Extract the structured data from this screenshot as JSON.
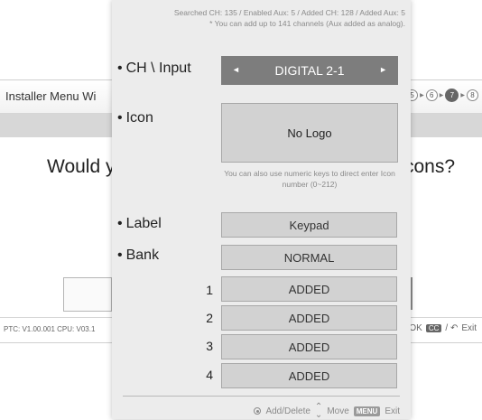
{
  "background": {
    "title": "Installer Menu Wi",
    "steps": [
      "5",
      "6",
      "7",
      "8"
    ],
    "active_step": "7",
    "question_left": "Would y",
    "question_right": "cons?",
    "version": "PTC: V1.00.001 CPU: V03.1",
    "nav_ok": "OK",
    "nav_cc": "CC",
    "nav_exit": "Exit"
  },
  "dialog": {
    "info_line1": "Searched CH: 135 / Enabled Aux: 5 / Added CH: 128 / Added Aux: 5",
    "info_line2": "* You can add up to 141 channels (Aux added as analog).",
    "ch_input_label": "CH \\ Input",
    "ch_input_value": "DIGITAL 2-1",
    "icon_label": "Icon",
    "icon_value": "No Logo",
    "icon_hint": "You can also use numeric keys to direct enter Icon number (0~212)",
    "label_label": "Label",
    "label_value": "Keypad",
    "bank_label": "Bank",
    "bank_value": "NORMAL",
    "banks": [
      {
        "num": "1",
        "status": "ADDED"
      },
      {
        "num": "2",
        "status": "ADDED"
      },
      {
        "num": "3",
        "status": "ADDED"
      },
      {
        "num": "4",
        "status": "ADDED"
      }
    ],
    "footer": {
      "add_delete": "Add/Delete",
      "move": "Move",
      "menu": "MENU",
      "exit": "Exit"
    }
  }
}
